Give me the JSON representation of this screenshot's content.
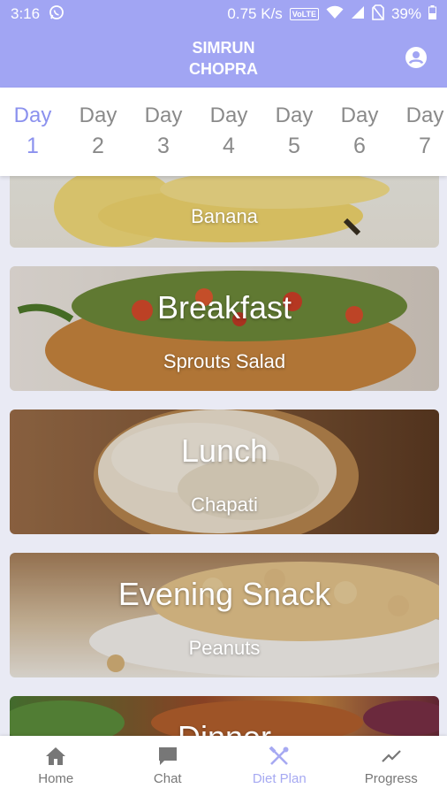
{
  "status_bar": {
    "time": "3:16",
    "speed": "0.75 K/s",
    "volte": "VoLTE",
    "battery": "39%"
  },
  "header": {
    "name_line1": "SIMRUN",
    "name_line2": "CHOPRA"
  },
  "days": [
    {
      "label": "Day",
      "num": "1"
    },
    {
      "label": "Day",
      "num": "2"
    },
    {
      "label": "Day",
      "num": "3"
    },
    {
      "label": "Day",
      "num": "4"
    },
    {
      "label": "Day",
      "num": "5"
    },
    {
      "label": "Day",
      "num": "6"
    },
    {
      "label": "Day",
      "num": "7"
    }
  ],
  "meals": [
    {
      "meal": "",
      "food": "Banana"
    },
    {
      "meal": "Breakfast",
      "food": "Sprouts Salad"
    },
    {
      "meal": "Lunch",
      "food": "Chapati"
    },
    {
      "meal": "Evening Snack",
      "food": "Peanuts"
    },
    {
      "meal": "Dinner",
      "food": ""
    }
  ],
  "nav": [
    {
      "label": "Home"
    },
    {
      "label": "Chat"
    },
    {
      "label": "Diet Plan"
    },
    {
      "label": "Progress"
    }
  ],
  "colors": {
    "accent": "#a1a5f3",
    "active_tab": "#8b91ee",
    "nav_active": "#a6a9f2"
  }
}
